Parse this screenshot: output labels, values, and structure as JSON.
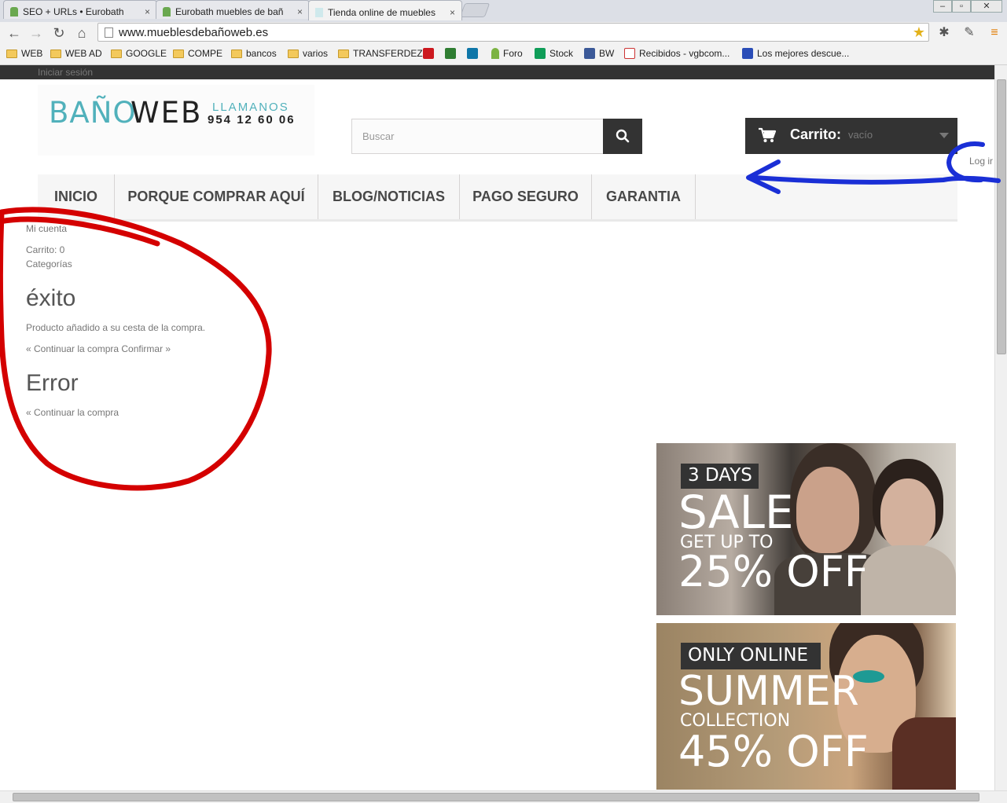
{
  "browser": {
    "tabs": [
      {
        "title": "SEO + URLs • Eurobath",
        "active": false
      },
      {
        "title": "Eurobath muebles de bañ",
        "active": false
      },
      {
        "title": "Tienda online de muebles",
        "active": true
      }
    ],
    "tab_close": "×",
    "url": "www.mueblesdebañoweb.es",
    "bookmarks": [
      "WEB",
      "WEB AD",
      "GOOGLE",
      "COMPE",
      "bancos",
      "varios",
      "TRANSFERDEZ",
      "Foro",
      "Stock",
      "BW",
      "Recibidos - vgbcom...",
      "Los mejores descue..."
    ]
  },
  "page": {
    "topbar_login": "Iniciar sesión",
    "logo": {
      "part1": "BAÑO",
      "part2": "WEB",
      "call_label": "LLAMANOS",
      "phone": "954 12 60 06"
    },
    "search_placeholder": "Buscar",
    "cart": {
      "label": "Carrito:",
      "value": "vacío"
    },
    "login_link": "Log ir",
    "menu": [
      "INICIO",
      "PORQUE COMPRAR AQUÍ",
      "BLOG/NOTICIAS",
      "PAGO SEGURO",
      "GARANTIA"
    ],
    "side": {
      "account": "Mi cuenta",
      "cart_count": "Carrito: 0",
      "categories": "Categorías",
      "success_title": "éxito",
      "success_msg": "Producto añadido a su cesta de la compra.",
      "success_links": "« Continuar la compra Confirmar »",
      "error_title": "Error",
      "error_link": "« Continuar la compra"
    },
    "banners": [
      {
        "tag": "3 DAYS",
        "line1": "SALE",
        "line2": "GET UP TO",
        "line3": "25% OFF"
      },
      {
        "tag": "ONLY ONLINE",
        "line1": "SUMMER",
        "line2": "COLLECTION",
        "line3": "45% OFF"
      }
    ]
  },
  "colors": {
    "accent_teal": "#51b1bb",
    "annotation_red": "#d40000",
    "annotation_blue": "#1a2fd6",
    "dark": "#333333"
  }
}
